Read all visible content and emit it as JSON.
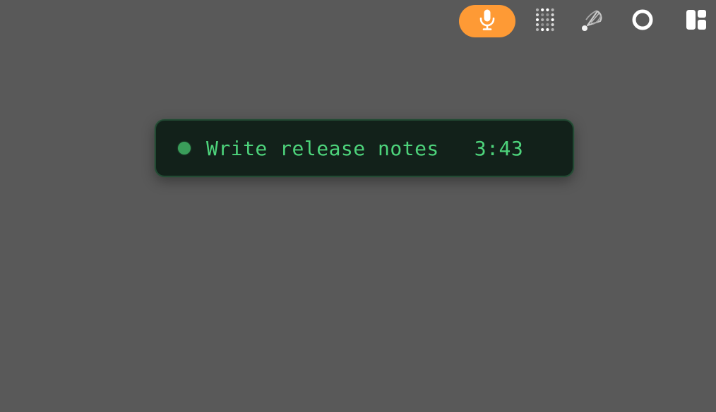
{
  "menubar": {
    "items": [
      {
        "name": "microphone",
        "icon": "microphone-icon",
        "active": true
      },
      {
        "name": "grid-dots",
        "icon": "grid-dots-icon"
      },
      {
        "name": "satellite",
        "icon": "satellite-dish-icon"
      },
      {
        "name": "circle",
        "icon": "circle-ring-icon"
      },
      {
        "name": "layout",
        "icon": "window-layout-icon"
      }
    ]
  },
  "timer": {
    "task": "Write release notes",
    "time": "3:43",
    "status": "running"
  },
  "colors": {
    "desktop": "#595959",
    "mic_accent": "#fe9a35",
    "timer_bg": "#12211a",
    "timer_text": "#4dd37b",
    "status_dot": "#3a9d5a"
  }
}
